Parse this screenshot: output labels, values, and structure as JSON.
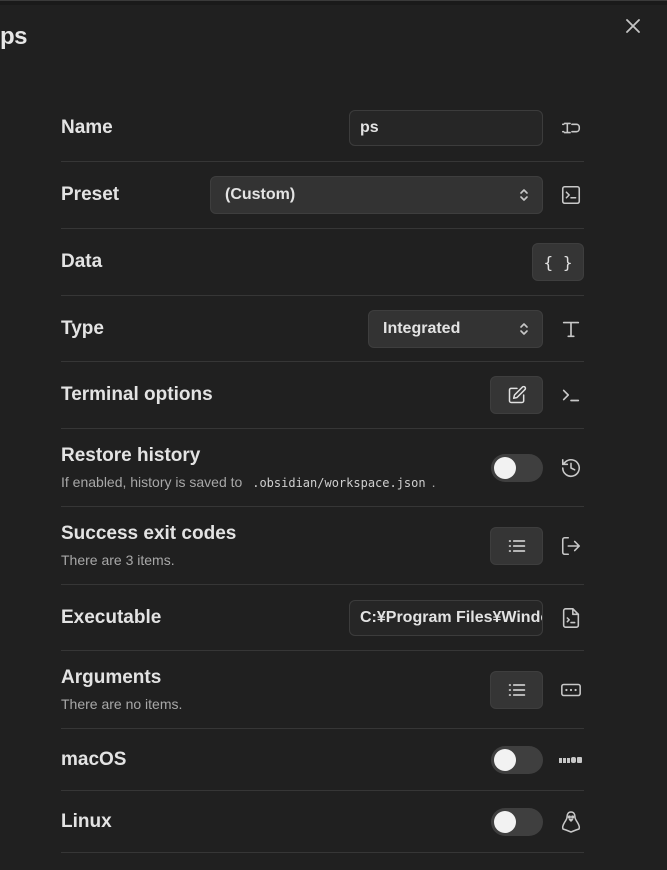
{
  "modal": {
    "title": "ps",
    "close_icon": "close-icon"
  },
  "rows": {
    "name": {
      "label": "Name",
      "value": "ps",
      "icon": "text-cursor-icon"
    },
    "preset": {
      "label": "Preset",
      "value": "(Custom)",
      "icon": "terminal-square-icon"
    },
    "data": {
      "label": "Data",
      "button_label": "{ }"
    },
    "type": {
      "label": "Type",
      "value": "Integrated",
      "icon": "type-icon"
    },
    "terminal_options": {
      "label": "Terminal options",
      "icon": "terminal-prompt-icon"
    },
    "restore_history": {
      "label": "Restore history",
      "desc_prefix": "If enabled, history is saved to",
      "desc_code": ".obsidian/workspace.json",
      "desc_suffix": ".",
      "enabled": false,
      "icon": "history-icon"
    },
    "success_exit_codes": {
      "label": "Success exit codes",
      "desc": "There are 3 items.",
      "icon": "log-out-icon"
    },
    "executable": {
      "label": "Executable",
      "value": "C:¥Program Files¥Windo",
      "icon": "file-terminal-icon"
    },
    "arguments": {
      "label": "Arguments",
      "desc": "There are no items.",
      "icon": "ellipsis-box-icon"
    },
    "macos": {
      "label": "macOS",
      "enabled": false,
      "icon": "macos-logo-icon"
    },
    "linux": {
      "label": "Linux",
      "enabled": false,
      "icon": "linux-tux-icon"
    }
  }
}
